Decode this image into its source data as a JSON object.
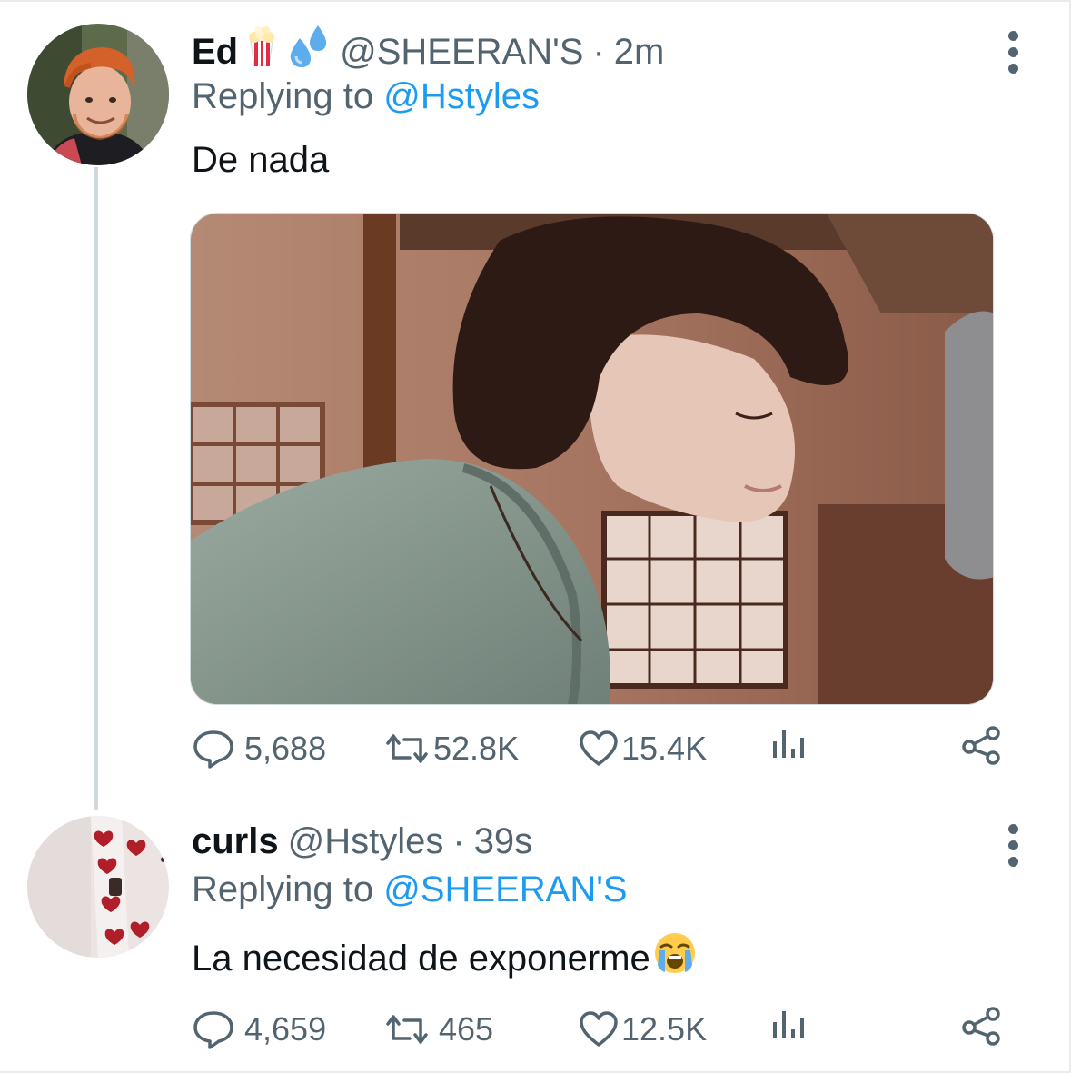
{
  "tweets": [
    {
      "name": "Ed",
      "emojis": [
        "popcorn-emoji",
        "sweat-droplets-emoji"
      ],
      "handle": "@SHEERAN'S",
      "separator": "·",
      "time": "2m",
      "replying_prefix": "Replying to",
      "replying_to": "@Hstyles",
      "text": "De nada",
      "has_media": true,
      "counts": {
        "replies": "5,688",
        "retweets": "52.8K",
        "likes": "15.4K"
      }
    },
    {
      "name": "curls",
      "handle": "@Hstyles",
      "separator": "·",
      "time": "39s",
      "replying_prefix": "Replying to",
      "replying_to": "@SHEERAN'S",
      "text": "La necesidad de exponerme",
      "text_emoji": "loudly-crying-face-emoji",
      "counts": {
        "replies": "4,659",
        "retweets": "465",
        "likes": "12.5K"
      }
    }
  ],
  "icons": {
    "reply": "speech-bubble-icon",
    "retweet": "retweet-arrows-icon",
    "like": "heart-icon",
    "analytics": "bar-chart-icon",
    "share": "share-nodes-icon",
    "more": "vertical-dots-icon"
  },
  "colors": {
    "text": "#0f1419",
    "secondary": "#536471",
    "link": "#1d9bf0",
    "thread_line": "#cfd9de"
  }
}
